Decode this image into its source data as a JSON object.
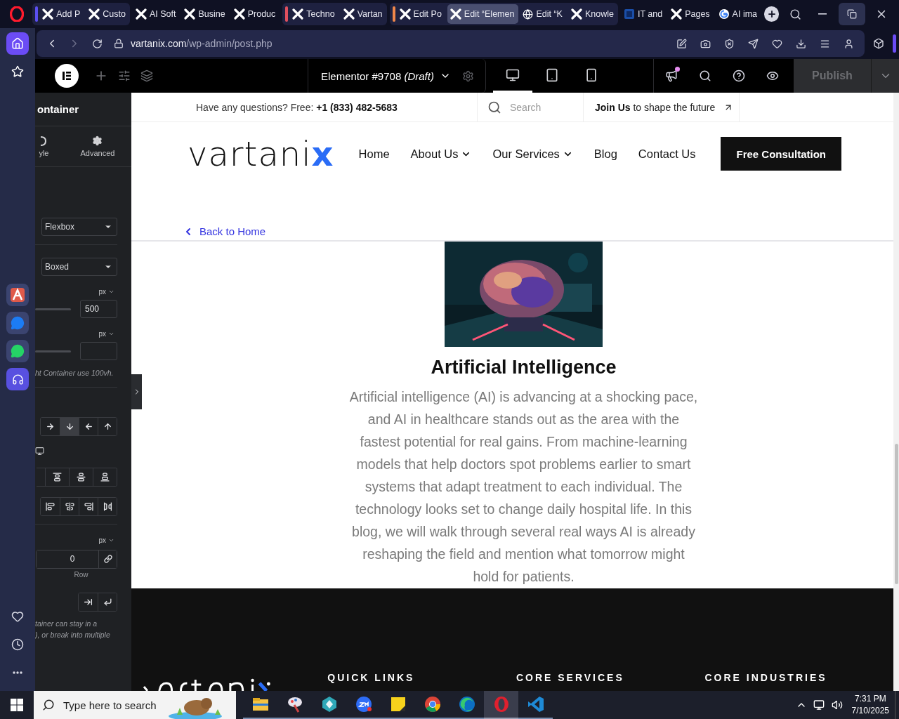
{
  "browser": {
    "tab_groups": [
      {
        "color": "#5b4ff2",
        "tabs": [
          {
            "title": "Add P",
            "kind": "x",
            "selected": false
          },
          {
            "title": "Custo",
            "kind": "x",
            "selected": false
          }
        ]
      },
      {
        "tabs": [
          {
            "title": "AI Soft",
            "kind": "x",
            "selected": false
          },
          {
            "title": "Busine",
            "kind": "x",
            "selected": false
          },
          {
            "title": "Produc",
            "kind": "x",
            "selected": false
          }
        ]
      },
      {
        "color": "#e0505e",
        "tabs": [
          {
            "title": "Techno",
            "kind": "x",
            "selected": false
          },
          {
            "title": "Vartan",
            "kind": "x",
            "selected": false
          }
        ]
      },
      {
        "color": "#f0874a",
        "tabs": [
          {
            "title": "Edit Po",
            "kind": "x",
            "selected": false
          },
          {
            "title": "Edit “Elemen",
            "kind": "x",
            "selected": true
          },
          {
            "title": "Edit “K",
            "kind": "globe",
            "selected": false
          },
          {
            "title": "Knowle",
            "kind": "x",
            "selected": false
          }
        ]
      },
      {
        "tabs": [
          {
            "title": "IT and",
            "kind": "square",
            "selected": false
          },
          {
            "title": "Pages",
            "kind": "x",
            "selected": false
          },
          {
            "title": "AI ima",
            "kind": "google",
            "selected": false
          }
        ]
      }
    ],
    "url_host": "vartanix.com",
    "url_path": "/wp-admin/post.php",
    "sidebar": [
      {
        "selected": true
      },
      {
        "selected": false
      }
    ]
  },
  "editor": {
    "title": "Elementor #9708 *(Draft)*",
    "devices": [
      {
        "selected": true
      },
      {
        "selected": false
      },
      {
        "selected": false
      }
    ],
    "publish": {
      "label": "Publish",
      "disabled": true
    }
  },
  "panel": {
    "title": "ontainer",
    "tabs": [
      "yle",
      "Advanced"
    ],
    "controls": [
      {
        "kind": "select",
        "value": "Flexbox"
      },
      {
        "kind": "divider"
      },
      {
        "kind": "select",
        "value": "Boxed"
      },
      {
        "kind": "unit",
        "unit": "px"
      },
      {
        "kind": "slider",
        "value": "500"
      },
      {
        "kind": "unit",
        "unit": "px"
      },
      {
        "kind": "slider"
      },
      {
        "kind": "note",
        "lines": [
          "ht Container use 100vh."
        ]
      },
      {
        "kind": "divider"
      },
      {
        "kind": "direction",
        "options": [
          {
            "selected": false
          },
          {
            "selected": true
          },
          {
            "selected": false
          },
          {
            "selected": false
          }
        ]
      },
      {
        "kind": "device"
      },
      {
        "kind": "justify",
        "options": [
          {
            "selected": false
          },
          {
            "selected": false
          },
          {
            "selected": false
          }
        ]
      },
      {
        "kind": "align",
        "options": [
          {
            "selected": false
          },
          {
            "selected": false
          },
          {
            "selected": false
          },
          {
            "selected": false
          }
        ]
      },
      {
        "kind": "divider"
      },
      {
        "kind": "unit",
        "unit": "px"
      },
      {
        "kind": "gap",
        "value": "0",
        "caption": "Row"
      },
      {
        "kind": "wrap",
        "options": [
          {
            "selected": false
          },
          {
            "selected": false
          }
        ]
      },
      {
        "kind": "note",
        "lines": [
          "tainer can stay in a",
          "), or break into multiple"
        ]
      }
    ]
  },
  "site": {
    "topbar": {
      "question": "Have any questions? Free: **+1 (833) 482-5683**",
      "search_placeholder": "Search",
      "join": "**Join Us** to shape the future"
    },
    "logo": "vartanix",
    "nav": [
      {
        "label": "Home",
        "dropdown": false
      },
      {
        "label": "About Us",
        "dropdown": true
      },
      {
        "label": "Our Services",
        "dropdown": true
      },
      {
        "label": "Blog",
        "dropdown": false
      },
      {
        "label": "Contact Us",
        "dropdown": false
      }
    ],
    "cta": "Free Consultation",
    "back": "Back to Home",
    "post": {
      "title": "Artificial Intelligence",
      "body": "Artificial intelligence (AI) is advancing at a shocking pace, and AI in healthcare stands out as the area with the fastest potential for real gains. From machine-learning models that help doctors spot problems earlier to smart systems that adapt treatment to each individual. The technology looks set to change daily hospital life. In this blog, we will walk through several real ways AI is already reshaping the field and mention what tomorrow might hold for patients."
    },
    "footer": {
      "headings": [
        "QUICK LINKS",
        "CORE SERVICES",
        "CORE INDUSTRIES"
      ]
    }
  },
  "taskbar": {
    "search_placeholder": "Type here to search",
    "apps": [
      {
        "active": false
      },
      {
        "active": false
      },
      {
        "active": false
      },
      {
        "active": false
      },
      {
        "active": false
      },
      {
        "active": false
      },
      {
        "active": false
      },
      {
        "active": true
      },
      {
        "active": false
      }
    ],
    "time": "7:31 PM",
    "date": "7/10/2025"
  }
}
